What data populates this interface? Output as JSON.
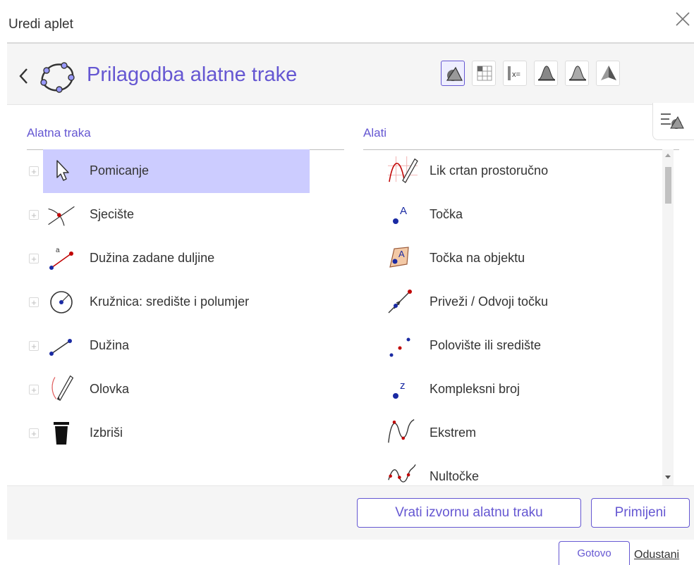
{
  "dialog": {
    "title": "Uredi aplet"
  },
  "header": {
    "title": "Prilagodba alatne trake"
  },
  "perspectives": [
    {
      "icon": "graphics-icon",
      "active": true
    },
    {
      "icon": "spreadsheet-icon",
      "active": false
    },
    {
      "icon": "cas-icon",
      "active": false
    },
    {
      "icon": "probability-icon",
      "active": false
    },
    {
      "icon": "probability-icon",
      "active": false
    },
    {
      "icon": "3d-graphics-icon",
      "active": false
    }
  ],
  "toolbar": {
    "heading": "Alatna traka",
    "items": [
      {
        "label": "Pomicanje",
        "icon": "move-arrow-icon",
        "selected": true
      },
      {
        "label": "Sjecište",
        "icon": "intersect-icon"
      },
      {
        "label": "Dužina zadane duljine",
        "icon": "segment-fixed-length-icon"
      },
      {
        "label": "Kružnica: središte i polumjer",
        "icon": "circle-center-radius-icon"
      },
      {
        "label": "Dužina",
        "icon": "segment-icon"
      },
      {
        "label": "Olovka",
        "icon": "pen-icon"
      },
      {
        "label": "Izbriši",
        "icon": "trash-icon"
      }
    ]
  },
  "tools": {
    "heading": "Alati",
    "items": [
      {
        "label": "Lik crtan prostoručno",
        "icon": "freehand-shape-icon"
      },
      {
        "label": "Točka",
        "icon": "point-icon",
        "glyph": "A"
      },
      {
        "label": "Točka na objektu",
        "icon": "point-on-object-icon",
        "glyph": "A"
      },
      {
        "label": "Priveži / Odvoji točku",
        "icon": "attach-detach-point-icon"
      },
      {
        "label": "Polovište ili središte",
        "icon": "midpoint-icon"
      },
      {
        "label": "Kompleksni broj",
        "icon": "complex-number-icon",
        "glyph": "z"
      },
      {
        "label": "Ekstrem",
        "icon": "extremum-icon"
      },
      {
        "label": "Nultočke",
        "icon": "roots-icon"
      }
    ]
  },
  "footer": {
    "reset_label": "Vrati izvornu alatnu traku",
    "apply_label": "Primijeni"
  },
  "bottom": {
    "done_label": "Gotovo",
    "cancel_label": "Odustani"
  },
  "colors": {
    "accent": "#6557d2",
    "selection": "#ccccff",
    "point": "#1a2aa3",
    "red": "#c00000"
  }
}
